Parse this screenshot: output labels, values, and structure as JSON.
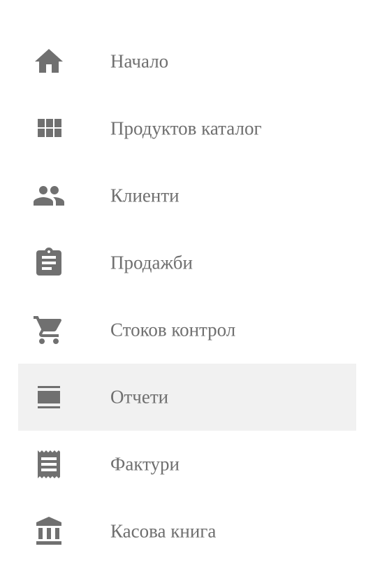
{
  "menu": {
    "items": [
      {
        "label": "Начало",
        "icon": "home-icon"
      },
      {
        "label": "Продуктов каталог",
        "icon": "grid-icon"
      },
      {
        "label": "Клиенти",
        "icon": "people-icon"
      },
      {
        "label": "Продажби",
        "icon": "clipboard-icon"
      },
      {
        "label": "Стоков контрол",
        "icon": "cart-icon"
      },
      {
        "label": "Отчети",
        "icon": "view-agenda-icon",
        "active": true
      },
      {
        "label": "Фактури",
        "icon": "receipt-icon"
      },
      {
        "label": "Касова книга",
        "icon": "bank-icon"
      }
    ]
  },
  "colors": {
    "icon": "#707070",
    "text": "#6f6f6f",
    "active_bg": "#f1f1f1"
  }
}
